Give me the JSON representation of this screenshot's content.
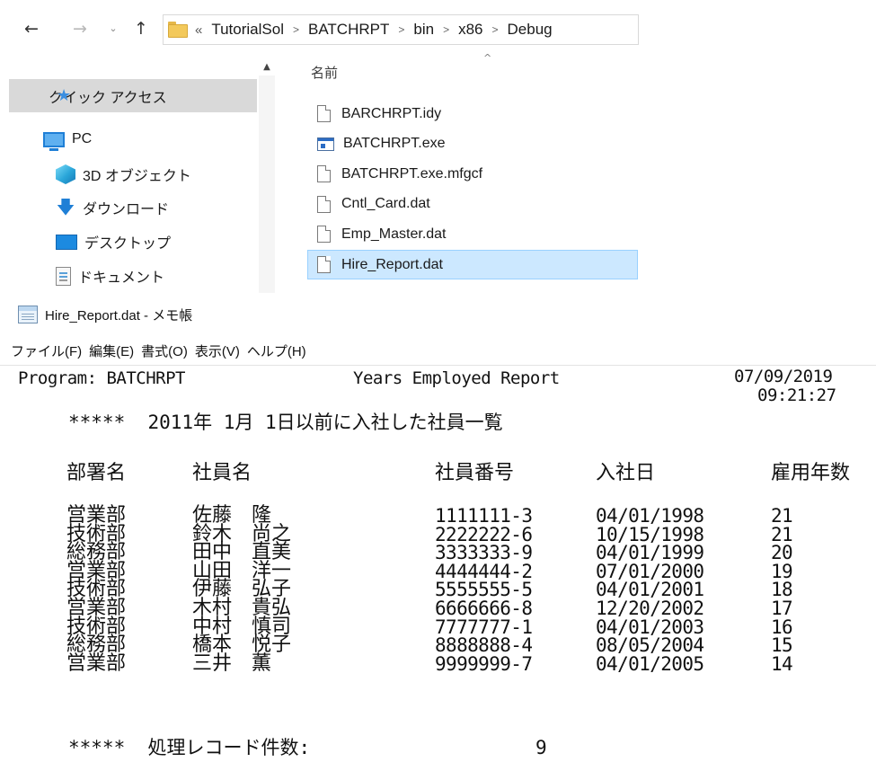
{
  "explorer": {
    "nav_buttons": {
      "back_icon": "arrow-left-icon",
      "forward_icon": "arrow-right-icon",
      "recent_icon": "chevron-down-icon",
      "up_icon": "arrow-up-icon"
    },
    "address": {
      "overflow": "«",
      "crumbs": [
        "TutorialSol",
        "BATCHRPT",
        "bin",
        "x86",
        "Debug"
      ]
    },
    "nav_pane": {
      "quick_access": "クイック アクセス",
      "pc": "PC",
      "objects_3d": "3D オブジェクト",
      "downloads": "ダウンロード",
      "desktop": "デスクトップ",
      "documents": "ドキュメント"
    },
    "file_list": {
      "column_name": "名前",
      "files": [
        {
          "name": "BARCHRPT.idy",
          "type": "file"
        },
        {
          "name": "BATCHRPT.exe",
          "type": "exe"
        },
        {
          "name": "BATCHRPT.exe.mfgcf",
          "type": "file"
        },
        {
          "name": "Cntl_Card.dat",
          "type": "file"
        },
        {
          "name": "Emp_Master.dat",
          "type": "file"
        },
        {
          "name": "Hire_Report.dat",
          "type": "file",
          "selected": true
        }
      ],
      "selection_color": "#cce8ff"
    }
  },
  "notepad": {
    "title": "Hire_Report.dat - メモ帳",
    "menu": {
      "file": "ファイル(F)",
      "edit": "編集(E)",
      "format": "書式(O)",
      "view": "表示(V)",
      "help": "ヘルプ(H)"
    },
    "report": {
      "program": "Program: BATCHRPT",
      "title": "Years Employed Report",
      "date": "07/09/2019",
      "time": "09:21:27",
      "heading": "*****  2011年 1月 1日以前に入社した社員一覧",
      "columns": {
        "dept": "部署名",
        "name": "社員名",
        "empno": "社員番号",
        "hired": "入社日",
        "years": "雇用年数"
      },
      "rows": [
        {
          "dept": "営業部",
          "name": "佐藤　隆",
          "empno": "1111111-3",
          "hired": "04/01/1998",
          "years": "21"
        },
        {
          "dept": "技術部",
          "name": "鈴木　尚之",
          "empno": "2222222-6",
          "hired": "10/15/1998",
          "years": "21"
        },
        {
          "dept": "総務部",
          "name": "田中　直美",
          "empno": "3333333-9",
          "hired": "04/01/1999",
          "years": "20"
        },
        {
          "dept": "営業部",
          "name": "山田　洋一",
          "empno": "4444444-2",
          "hired": "07/01/2000",
          "years": "19"
        },
        {
          "dept": "技術部",
          "name": "伊藤　弘子",
          "empno": "5555555-5",
          "hired": "04/01/2001",
          "years": "18"
        },
        {
          "dept": "営業部",
          "name": "木村　貴弘",
          "empno": "6666666-8",
          "hired": "12/20/2002",
          "years": "17"
        },
        {
          "dept": "技術部",
          "name": "中村　慎司",
          "empno": "7777777-1",
          "hired": "04/01/2003",
          "years": "16"
        },
        {
          "dept": "総務部",
          "name": "橋本　悦子",
          "empno": "8888888-4",
          "hired": "08/05/2004",
          "years": "15"
        },
        {
          "dept": "営業部",
          "name": "三井　薫",
          "empno": "9999999-7",
          "hired": "04/01/2005",
          "years": "14"
        }
      ],
      "footer_label": "*****  処理レコード件数:",
      "footer_count": "9"
    }
  }
}
